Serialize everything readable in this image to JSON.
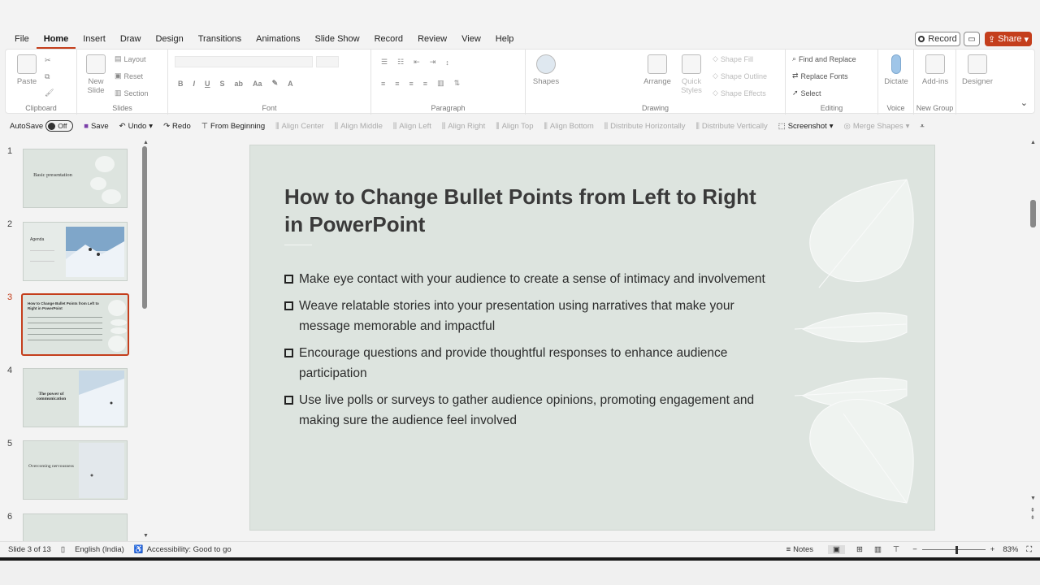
{
  "menu": {
    "tabs": [
      "File",
      "Home",
      "Insert",
      "Draw",
      "Design",
      "Transitions",
      "Animations",
      "Slide Show",
      "Record",
      "Review",
      "View",
      "Help"
    ],
    "active": "Home",
    "record_label": "Record",
    "share_label": "Share"
  },
  "ribbon": {
    "clipboard": {
      "paste": "Paste",
      "label": "Clipboard"
    },
    "slides": {
      "new_slide": "New Slide",
      "layout": "Layout",
      "reset": "Reset",
      "section": "Section",
      "label": "Slides"
    },
    "font": {
      "label": "Font"
    },
    "paragraph": {
      "label": "Paragraph"
    },
    "drawing": {
      "shapes": "Shapes",
      "arrange": "Arrange",
      "quick_styles": "Quick Styles",
      "shape_fill": "Shape Fill",
      "shape_outline": "Shape Outline",
      "shape_effects": "Shape Effects",
      "label": "Drawing"
    },
    "editing": {
      "find_replace": "Find and Replace",
      "replace_fonts": "Replace Fonts",
      "select": "Select",
      "label": "Editing"
    },
    "voice": {
      "dictate": "Dictate",
      "label": "Voice"
    },
    "addins": {
      "addins": "Add-ins",
      "label": "New Group"
    },
    "designer": {
      "designer": "Designer"
    }
  },
  "qat": {
    "autosave": "AutoSave",
    "toggle": "Off",
    "save": "Save",
    "undo": "Undo",
    "redo": "Redo",
    "from_beginning": "From Beginning",
    "align_center": "Align Center",
    "align_middle": "Align Middle",
    "align_left": "Align Left",
    "align_right": "Align Right",
    "align_top": "Align Top",
    "align_bottom": "Align Bottom",
    "distribute_h": "Distribute Horizontally",
    "distribute_v": "Distribute Vertically",
    "screenshot": "Screenshot",
    "merge_shapes": "Merge Shapes"
  },
  "thumbnails": [
    {
      "num": "1",
      "title": "Basic presentation"
    },
    {
      "num": "2",
      "title": "Agenda"
    },
    {
      "num": "3",
      "title": "How to Change Bullet Points from Left to Right in PowerPoint"
    },
    {
      "num": "4",
      "title": "The power of communication"
    },
    {
      "num": "5",
      "title": "Overcoming nervousness"
    },
    {
      "num": "6",
      "title": ""
    }
  ],
  "slide": {
    "title": "How to Change Bullet Points from Left to Right in PowerPoint",
    "bullets": [
      "Make eye contact with your audience to create a sense of intimacy and involvement",
      "Weave relatable stories into your presentation using narratives that make your message memorable and impactful",
      "Encourage questions and provide thoughtful responses to enhance audience participation",
      "Use live polls or surveys to gather audience opinions, promoting engagement and making sure the audience feel involved"
    ]
  },
  "status": {
    "slide_info": "Slide 3 of 13",
    "language": "English (India)",
    "accessibility": "Accessibility: Good to go",
    "notes": "Notes",
    "zoom": "83%",
    "zoom_level": 0.55
  },
  "colors": {
    "accent": "#c43e1c",
    "slide_bg": "#dde4df"
  }
}
